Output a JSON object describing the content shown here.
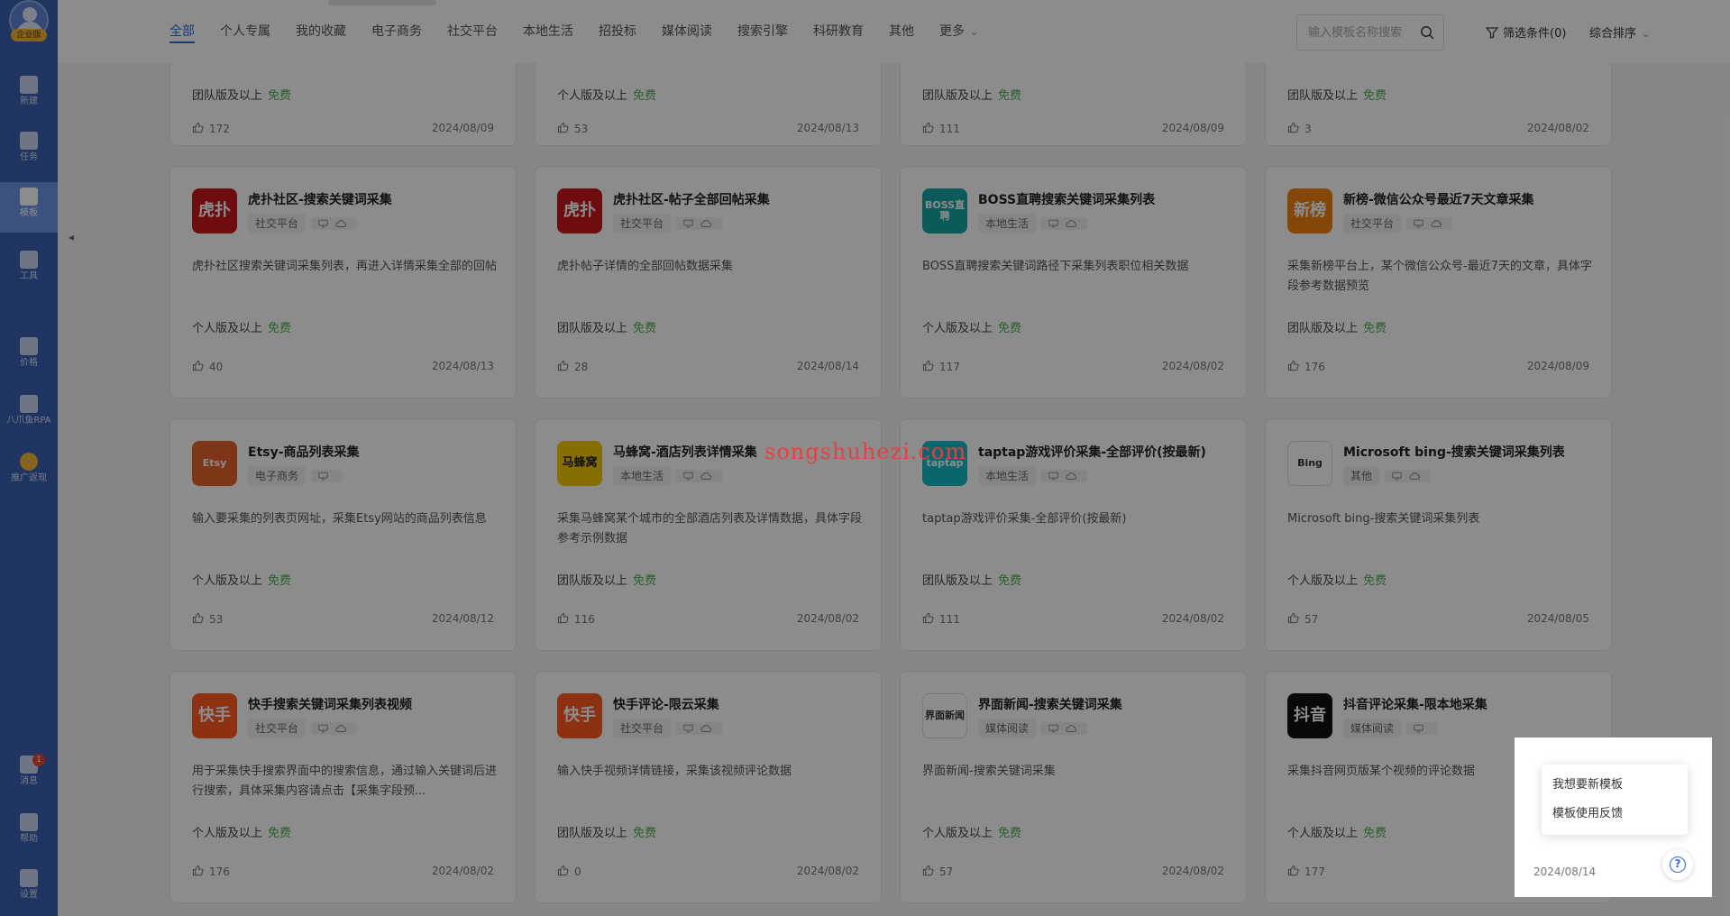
{
  "sidebar": {
    "edition_badge": "企业版",
    "items": [
      {
        "label": "新建",
        "icon": "plus-square-icon"
      },
      {
        "label": "任务",
        "icon": "bookmark-icon"
      },
      {
        "label": "模板",
        "icon": "template-icon"
      },
      {
        "label": "工具",
        "icon": "toolbox-icon"
      },
      {
        "label": "价格",
        "icon": "crown-icon"
      },
      {
        "label": "八爪鱼RPA",
        "icon": "octopus-icon"
      },
      {
        "label": "推广返现",
        "icon": "coin-icon"
      },
      {
        "label": "消息",
        "icon": "bell-icon",
        "badge": "1"
      },
      {
        "label": "帮助",
        "icon": "question-icon"
      },
      {
        "label": "设置",
        "icon": "gear-icon"
      }
    ]
  },
  "nav": {
    "tabs": [
      "全部",
      "个人专属",
      "我的收藏",
      "电子商务",
      "社交平台",
      "本地生活",
      "招投标",
      "媒体阅读",
      "搜索引擎",
      "科研教育",
      "其他",
      "更多"
    ],
    "active_tab": "全部",
    "search_placeholder": "输入模板名称搜索",
    "filter_label": "筛选条件(0)",
    "sort_label": "综合排序"
  },
  "row0": [
    {
      "edition": "团队版及以上",
      "free": "免费",
      "likes": "172",
      "date": "2024/08/09"
    },
    {
      "edition": "个人版及以上",
      "free": "免费",
      "likes": "53",
      "date": "2024/08/13"
    },
    {
      "edition": "团队版及以上",
      "free": "免费",
      "likes": "111",
      "date": "2024/08/09"
    },
    {
      "edition": "团队版及以上",
      "free": "免费",
      "likes": "3",
      "date": "2024/08/02"
    }
  ],
  "cards": [
    {
      "logo_text": "虎扑",
      "logo_color": "#c8191d",
      "title": "虎扑社区-搜索关键词采集",
      "tag": "社交平台",
      "cloud": true,
      "desc": "虎扑社区搜索关键词采集列表，再进入详情采集全部的回帖",
      "edition": "个人版及以上",
      "free": "免费",
      "likes": "40",
      "date": "2024/08/13"
    },
    {
      "logo_text": "虎扑",
      "logo_color": "#c8191d",
      "title": "虎扑社区-帖子全部回帖采集",
      "tag": "社交平台",
      "cloud": true,
      "desc": "虎扑帖子详情的全部回帖数据采集",
      "edition": "团队版及以上",
      "free": "免费",
      "likes": "28",
      "date": "2024/08/14"
    },
    {
      "logo_text": "BOSS直聘",
      "logo_color": "#14a7a7",
      "title": "BOSS直聘搜索关键词采集列表",
      "tag": "本地生活",
      "cloud": true,
      "desc": "BOSS直聘搜索关键词路径下采集列表职位相关数据",
      "edition": "个人版及以上",
      "free": "免费",
      "likes": "117",
      "date": "2024/08/02"
    },
    {
      "logo_text": "新榜",
      "logo_color": "#f0820f",
      "title": "新榜-微信公众号最近7天文章采集",
      "tag": "社交平台",
      "cloud": true,
      "desc": "采集新榜平台上，某个微信公众号-最近7天的文章，具体字段参考数据预览",
      "edition": "团队版及以上",
      "free": "免费",
      "likes": "176",
      "date": "2024/08/09"
    },
    {
      "logo_text": "Etsy",
      "logo_color": "#e8612a",
      "title": "Etsy-商品列表采集",
      "tag": "电子商务",
      "cloud": false,
      "desc": "输入要采集的列表页网址，采集Etsy网站的商品列表信息",
      "edition": "个人版及以上",
      "free": "免费",
      "likes": "53",
      "date": "2024/08/12"
    },
    {
      "logo_text": "马蜂窝",
      "logo_color": "#f7c900",
      "title": "马蜂窝-酒店列表详情采集",
      "tag": "本地生活",
      "cloud": true,
      "desc": "采集马蜂窝某个城市的全部酒店列表及详情数据，具体字段参考示例数据",
      "edition": "团队版及以上",
      "free": "免费",
      "likes": "116",
      "date": "2024/08/02"
    },
    {
      "logo_text": "taptap",
      "logo_color": "#15b9c6",
      "title": "taptap游戏评价采集-全部评价(按最新)",
      "tag": "本地生活",
      "cloud": true,
      "desc": "taptap游戏评价采集-全部评价(按最新)",
      "edition": "团队版及以上",
      "free": "免费",
      "likes": "111",
      "date": "2024/08/02"
    },
    {
      "logo_text": "Bing",
      "logo_color": "#ffffff",
      "title": "Microsoft bing-搜索关键词采集列表",
      "tag": "其他",
      "cloud": true,
      "desc": "Microsoft bing-搜索关键词采集列表",
      "edition": "个人版及以上",
      "free": "免费",
      "likes": "57",
      "date": "2024/08/05"
    },
    {
      "logo_text": "快手",
      "logo_color": "#ff5a1f",
      "title": "快手搜索关键词采集列表视频",
      "tag": "社交平台",
      "cloud": true,
      "desc": "用于采集快手搜索界面中的搜索信息，通过输入关键词后进行搜索，具体采集内容请点击【采集字段预...",
      "edition": "个人版及以上",
      "free": "免费",
      "likes": "176",
      "date": "2024/08/02"
    },
    {
      "logo_text": "快手",
      "logo_color": "#ff5a1f",
      "title": "快手评论-限云采集",
      "tag": "社交平台",
      "cloud": true,
      "desc": "输入快手视频详情链接，采集该视频评论数据",
      "edition": "团队版及以上",
      "free": "免费",
      "likes": "0",
      "date": "2024/08/02"
    },
    {
      "logo_text": "界面新闻",
      "logo_color": "#ffffff",
      "title": "界面新闻-搜索关键词采集",
      "tag": "媒体阅读",
      "cloud": true,
      "desc": "界面新闻-搜索关键词采集",
      "edition": "个人版及以上",
      "free": "免费",
      "likes": "57",
      "date": "2024/08/02"
    },
    {
      "logo_text": "抖音",
      "logo_color": "#111111",
      "title": "抖音评论采集-限本地采集",
      "tag": "媒体阅读",
      "cloud": false,
      "desc": "采集抖音网页版某个视频的评论数据",
      "edition": "个人版及以上",
      "free": "免费",
      "likes": "177",
      "date": "2024/08/14"
    }
  ],
  "watermark": "songshuhezi.com",
  "help_menu": {
    "items": [
      "我想要新模板",
      "模板使用反馈"
    ]
  }
}
